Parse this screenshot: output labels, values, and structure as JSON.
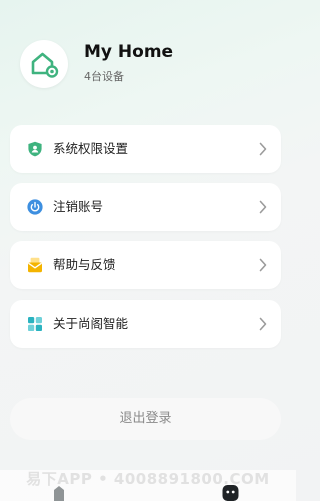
{
  "header": {
    "home_name": "My Home",
    "device_count": "4台设备",
    "avatar_icon": "home-icon"
  },
  "menu": [
    {
      "label": "系统权限设置",
      "icon": "shield-user-icon",
      "color": "#3fb37f"
    },
    {
      "label": "注销账号",
      "icon": "power-icon",
      "color": "#3d8fe0"
    },
    {
      "label": "帮助与反馈",
      "icon": "mail-help-icon",
      "color": "#f4b400"
    },
    {
      "label": "关于尚阁智能",
      "icon": "grid-icon",
      "color": "#2bb3c0"
    }
  ],
  "logout": {
    "label": "退出登录"
  },
  "watermark": "易下APP • 4008891800.COM",
  "colors": {
    "accent": "#3fb37f",
    "background": "#f2f3f4",
    "card": "#ffffff"
  }
}
